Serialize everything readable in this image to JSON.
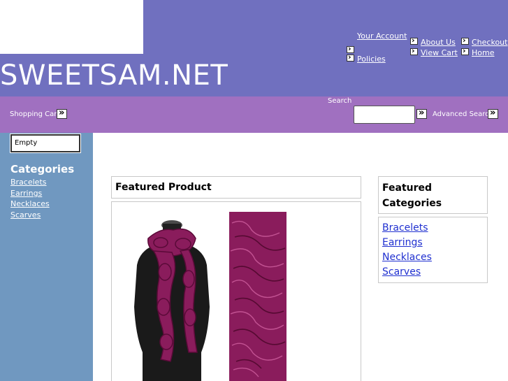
{
  "header": {
    "site_title": "SWEETSAM.NET",
    "nav": {
      "your_account": "Your Account",
      "policies": "Policies",
      "about_us": "About Us",
      "view_cart": "View Cart",
      "checkout": "Checkout",
      "home": "Home"
    }
  },
  "toolbar": {
    "shopping_cart_label": "Shopping Cart",
    "search_label": "Search",
    "search_value": "",
    "advanced_search_label": "Advanced Search"
  },
  "sidebar": {
    "cart_status": "Empty",
    "categories_heading": "Categories",
    "categories": [
      "Bracelets",
      "Earrings",
      "Necklaces",
      "Scarves"
    ]
  },
  "main": {
    "featured_product_heading": "Featured Product",
    "product_image_alt": "magenta ruffle scarf"
  },
  "featured_categories": {
    "heading": "Featured Categories",
    "items": [
      "Bracelets",
      "Earrings",
      "Necklaces",
      "Scarves"
    ]
  },
  "colors": {
    "header_bg": "#7070bf",
    "bar_bg": "#a070c0",
    "sidebar_bg": "#7098c0",
    "scarf": "#8a1c5c",
    "link": "#2030d0"
  }
}
